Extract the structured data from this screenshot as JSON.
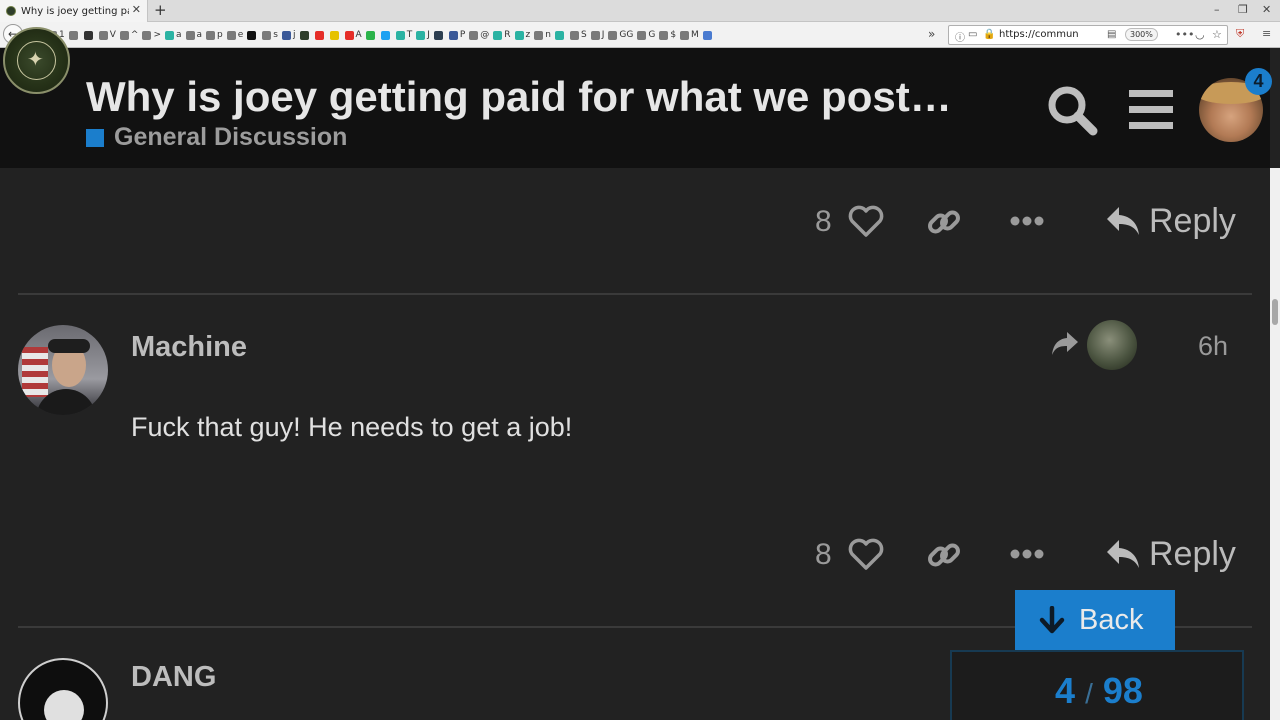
{
  "browser": {
    "tab_title": "Why is joey getting paid",
    "new_tab_label": "+",
    "url": "https://community",
    "zoom": "300%",
    "bookmarks": [
      {
        "label": "1",
        "color": "#7a7a7a"
      },
      {
        "label": "",
        "color": "#7a7a7a"
      },
      {
        "label": "",
        "color": "#333333"
      },
      {
        "label": "V",
        "color": "#7a7a7a"
      },
      {
        "label": "^",
        "color": "#7a7a7a"
      },
      {
        "label": ">",
        "color": "#7a7a7a"
      },
      {
        "label": "a",
        "color": "#2bb3a3"
      },
      {
        "label": "a",
        "color": "#7a7a7a"
      },
      {
        "label": "p",
        "color": "#7a7a7a"
      },
      {
        "label": "e",
        "color": "#7a7a7a"
      },
      {
        "label": "",
        "color": "#111111"
      },
      {
        "label": "s",
        "color": "#7a7a7a"
      },
      {
        "label": "j",
        "color": "#3b5998"
      },
      {
        "label": "",
        "color": "#2e3d2a"
      },
      {
        "label": "",
        "color": "#e52d27"
      },
      {
        "label": "",
        "color": "#e6c200"
      },
      {
        "label": "A",
        "color": "#e52d27"
      },
      {
        "label": "",
        "color": "#2bb34a"
      },
      {
        "label": "",
        "color": "#1da1f2"
      },
      {
        "label": "T",
        "color": "#2bb3a3"
      },
      {
        "label": "J",
        "color": "#2bb3a3"
      },
      {
        "label": "",
        "color": "#2c3e50"
      },
      {
        "label": "P",
        "color": "#3b5998"
      },
      {
        "label": "@",
        "color": "#7a7a7a"
      },
      {
        "label": "R",
        "color": "#2bb3a3"
      },
      {
        "label": "z",
        "color": "#2bb3a3"
      },
      {
        "label": "n",
        "color": "#7a7a7a"
      },
      {
        "label": "",
        "color": "#2bb3a3"
      },
      {
        "label": "S",
        "color": "#7a7a7a"
      },
      {
        "label": "J",
        "color": "#7a7a7a"
      },
      {
        "label": "GG",
        "color": "#7a7a7a"
      },
      {
        "label": "G",
        "color": "#7a7a7a"
      },
      {
        "label": "$",
        "color": "#7a7a7a"
      },
      {
        "label": "M",
        "color": "#7a7a7a"
      },
      {
        "label": "",
        "color": "#4a7bd0"
      }
    ]
  },
  "header": {
    "title": "Why is joey getting paid for what we post…",
    "category": "General Discussion",
    "category_color": "#1b7ecc",
    "notification_count": "4"
  },
  "posts": [
    {
      "like_count": "8",
      "reply_label": "Reply"
    },
    {
      "username": "Machine",
      "time": "6h",
      "body": "Fuck that guy! He needs to get a job!",
      "like_count": "8",
      "reply_label": "Reply"
    },
    {
      "username": "DANG"
    }
  ],
  "timeline": {
    "back_label": "Back",
    "current": "4",
    "separator": "/",
    "total": "98"
  },
  "colors": {
    "accent": "#1b7ecc",
    "background": "#222222",
    "header_bg": "#111111"
  }
}
